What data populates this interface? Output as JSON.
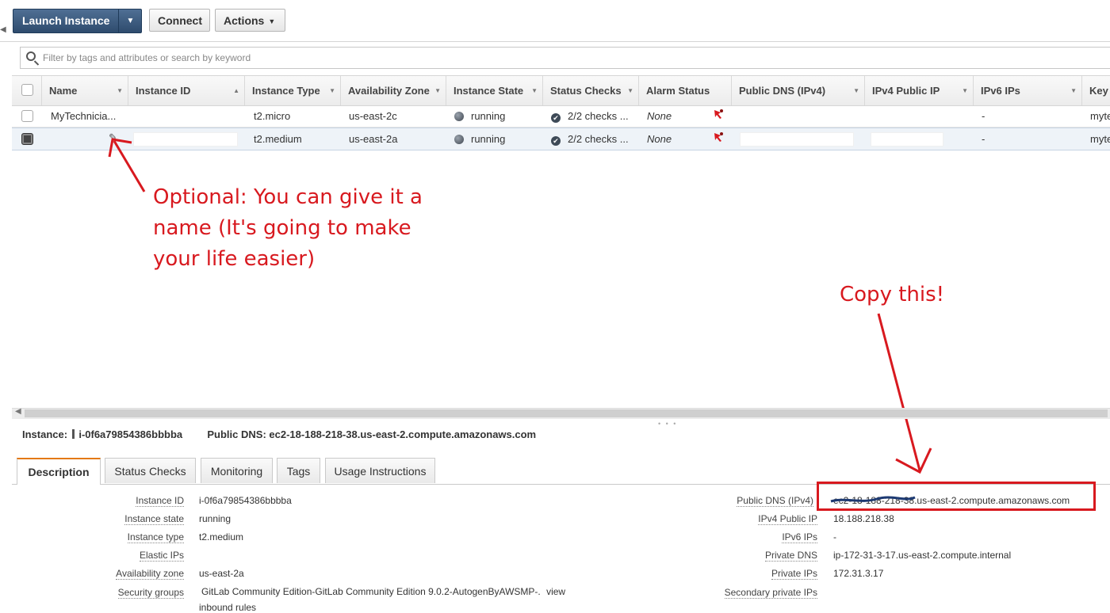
{
  "toolbar": {
    "launch_label": "Launch Instance",
    "connect_label": "Connect",
    "actions_label": "Actions"
  },
  "search": {
    "placeholder": "Filter by tags and attributes or search by keyword"
  },
  "table": {
    "columns": [
      "Name",
      "Instance ID",
      "Instance Type",
      "Availability Zone",
      "Instance State",
      "Status Checks",
      "Alarm Status",
      "Public DNS (IPv4)",
      "IPv4 Public IP",
      "IPv6 IPs",
      "Key"
    ],
    "rows": [
      {
        "name": "MyTechnicia...",
        "instance_id": "",
        "type": "t2.micro",
        "zone": "us-east-2c",
        "state": "running",
        "checks": "2/2 checks ...",
        "alarm": "None",
        "dns": "",
        "ip": "",
        "ipv6": "-",
        "key": "myte"
      },
      {
        "name": "",
        "instance_id": "",
        "type": "t2.medium",
        "zone": "us-east-2a",
        "state": "running",
        "checks": "2/2 checks ...",
        "alarm": "None",
        "dns": "",
        "ip": "",
        "ipv6": "-",
        "key": "myte"
      }
    ]
  },
  "annotations": {
    "optional_text": "Optional: You can give it a name (It's going to make your life easier)",
    "copy_text": "Copy this!",
    "color": "#d8191f"
  },
  "details": {
    "instance_label": "Instance:",
    "instance_value": "i-0f6a79854386bbbba",
    "dns_label": "Public DNS:",
    "dns_value": "ec2-18-188-218-38.us-east-2.compute.amazonaws.com",
    "tabs": [
      "Description",
      "Status Checks",
      "Monitoring",
      "Tags",
      "Usage Instructions"
    ],
    "left_fields": [
      {
        "label": "Instance ID",
        "value": "i-0f6a79854386bbbba"
      },
      {
        "label": "Instance state",
        "value": "running"
      },
      {
        "label": "Instance type",
        "value": "t2.medium"
      },
      {
        "label": "Elastic IPs",
        "value": ""
      },
      {
        "label": "Availability zone",
        "value": "us-east-2a"
      },
      {
        "label": "Security groups",
        "value": "GitLab Community Edition-GitLab Community Edition 9.0.2-AutogenByAWSMP-.",
        "link": "view",
        "value_line2": "inbound rules"
      }
    ],
    "right_fields": [
      {
        "label": "Public DNS (IPv4)",
        "value": "ec2-18-188-218-38.us-east-2.compute.amazonaws.com"
      },
      {
        "label": "IPv4 Public IP",
        "value": "18.188.218.38"
      },
      {
        "label": "IPv6 IPs",
        "value": "-"
      },
      {
        "label": "Private DNS",
        "value": "ip-172-31-3-17.us-east-2.compute.internal"
      },
      {
        "label": "Private IPs",
        "value": "172.31.3.17"
      },
      {
        "label": "Secondary private IPs",
        "value": ""
      }
    ]
  }
}
